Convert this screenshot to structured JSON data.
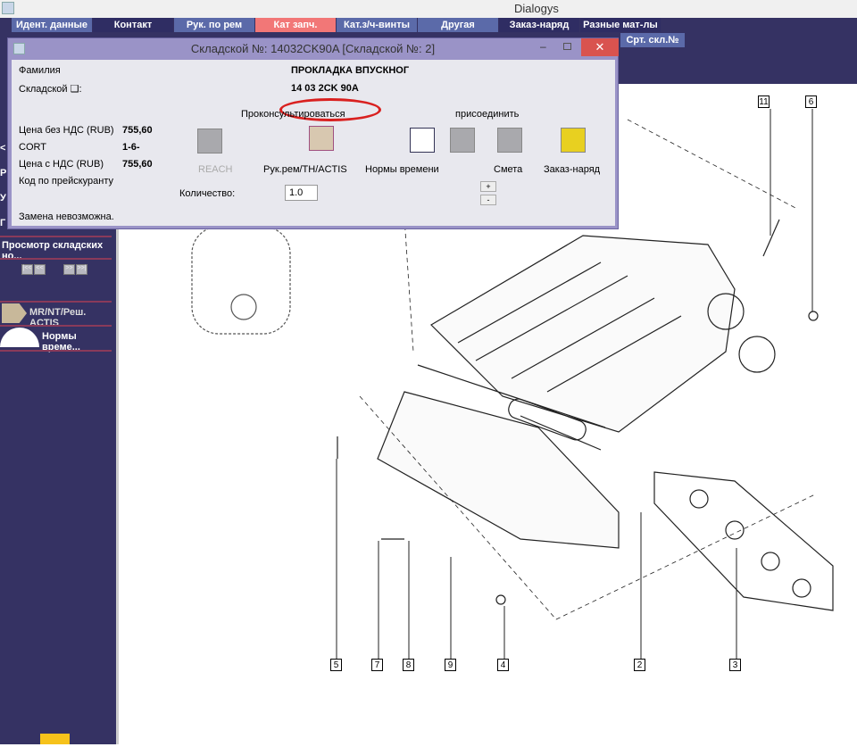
{
  "app": {
    "title": "Dialogys"
  },
  "tabs": [
    {
      "label": "Идент. данные",
      "state": "light"
    },
    {
      "label": "Контакт",
      "state": "dark"
    },
    {
      "label": "Рук. по рем",
      "state": "light"
    },
    {
      "label": "Кат запч.",
      "state": "active"
    },
    {
      "label": "Кат.з/ч-винты",
      "state": "light"
    },
    {
      "label": "Другая",
      "state": "light"
    },
    {
      "label": "Заказ-наряд",
      "state": "dark"
    },
    {
      "label": "Разные мат-лы",
      "state": "dark"
    }
  ],
  "subtab": "Срт. скл.№",
  "sidebar": {
    "clipped": [
      "<",
      "Р",
      "У",
      "Г"
    ],
    "browse": "Просмотр складских но...",
    "nav": [
      "|<<",
      "<<",
      ">>",
      ">>|"
    ],
    "actis": "MR/NT/Реш. ACTIS",
    "norms": "Нормы време..."
  },
  "dialog": {
    "title": "Складской №: 14032CK90A [Складской №: 2]",
    "family_label": "Фамилия",
    "family_value": "ПРОКЛАДКА ВПУСКНОГ",
    "stock_label": "Складской ❑:",
    "stock_value": "14 03 2CK 90A",
    "consult_label": "Проконсультироваться",
    "attach_label": "присоединить",
    "price_net_label": "Цена без НДС (RUB)",
    "price_net": "755,60",
    "cort_label": "CORT",
    "cort": "1-6-",
    "price_gross_label": "Цена с НДС (RUB)",
    "price_gross": "755,60",
    "pricelist_label": "Код по прейскуранту",
    "replacement": "Замена невозможна.",
    "qty_label": "Количество:",
    "qty": "1.0",
    "plus": "+",
    "minus": "-",
    "buttons": {
      "reach": "REACH",
      "repair": "Рук.рем/TH/ACTIS",
      "norms": "Нормы времени",
      "estimate": "Смета",
      "order": "Заказ-наряд"
    },
    "highlight_color": "#d9201f"
  },
  "callouts": [
    "11",
    "6",
    "5",
    "7",
    "8",
    "9",
    "4",
    "2",
    "3"
  ]
}
